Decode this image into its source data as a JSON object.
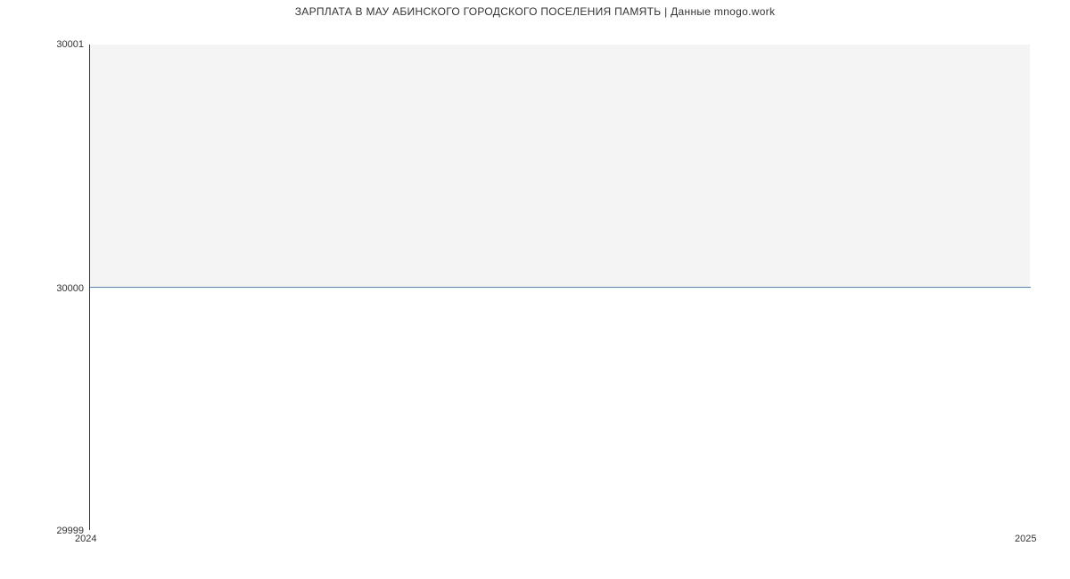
{
  "chart_data": {
    "type": "line",
    "title": "ЗАРПЛАТА В МАУ АБИНСКОГО ГОРОДСКОГО ПОСЕЛЕНИЯ ПАМЯТЬ | Данные mnogo.work",
    "x": [
      2024,
      2025
    ],
    "values": [
      30000,
      30000
    ],
    "xlabel": "",
    "ylabel": "",
    "ylim": [
      29999,
      30001
    ],
    "xlim": [
      2024,
      2025
    ],
    "y_ticks": [
      29999,
      30000,
      30001
    ],
    "x_ticks": [
      2024,
      2025
    ],
    "line_color": "#4a86e8"
  },
  "title": "ЗАРПЛАТА В МАУ АБИНСКОГО ГОРОДСКОГО ПОСЕЛЕНИЯ ПАМЯТЬ | Данные mnogo.work",
  "y_labels": {
    "0": "29999",
    "1": "30000",
    "2": "30001"
  },
  "x_labels": {
    "0": "2024",
    "1": "2025"
  }
}
